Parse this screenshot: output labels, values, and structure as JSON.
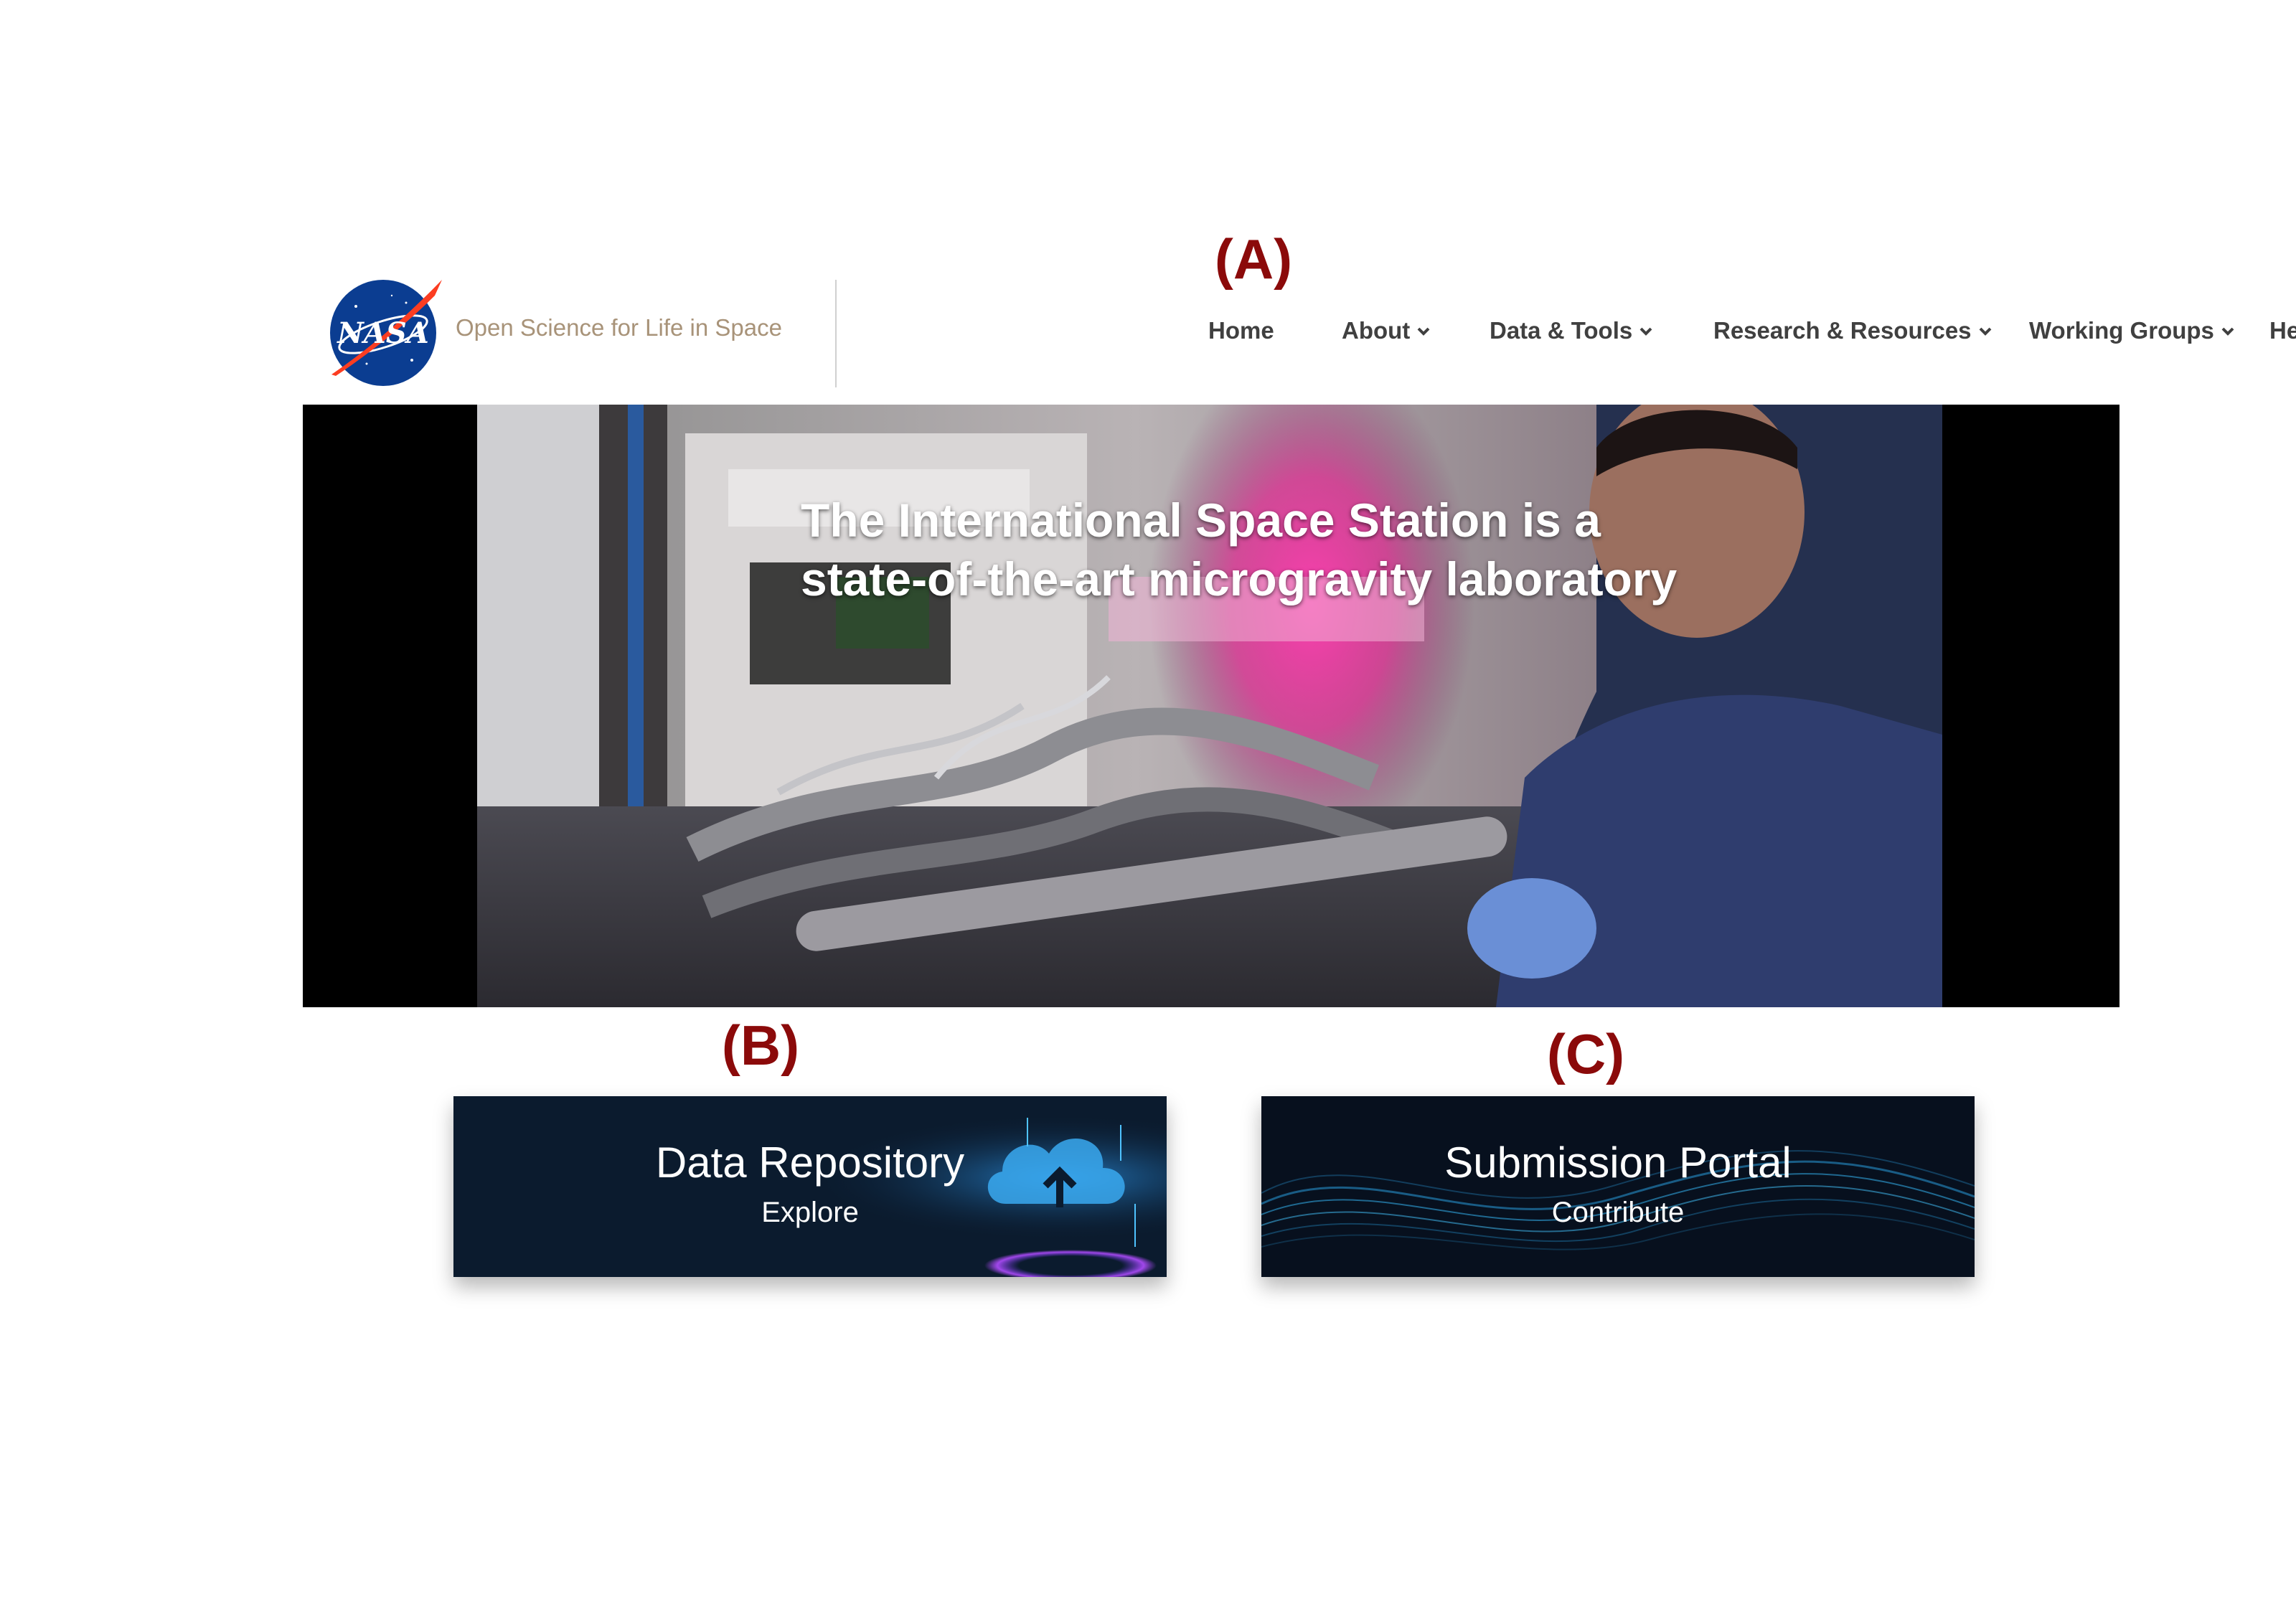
{
  "annotations": {
    "a": "(A)",
    "b": "(B)",
    "c": "(C)"
  },
  "header": {
    "logo_text": "NASA",
    "site_title": "Open Science for Life in Space",
    "nav": [
      {
        "label": "Home",
        "has_dropdown": false
      },
      {
        "label": "About",
        "has_dropdown": true
      },
      {
        "label": "Data & Tools",
        "has_dropdown": true
      },
      {
        "label": "Research & Resources",
        "has_dropdown": true
      },
      {
        "label": "Working Groups",
        "has_dropdown": true
      },
      {
        "label": "Help",
        "has_dropdown": true
      }
    ]
  },
  "hero": {
    "title_line1": "The International Space Station is a",
    "title_line2": "state-of-the-art microgravity laboratory"
  },
  "cards": {
    "data_repository": {
      "title": "Data Repository",
      "subtitle": "Explore",
      "icon": "cloud-upload-icon"
    },
    "submission_portal": {
      "title": "Submission Portal",
      "subtitle": "Contribute",
      "icon": "data-wave-graphic"
    }
  },
  "colors": {
    "annotation": "#8b0a0a",
    "brand_title": "#a89379",
    "nav_text": "#404040",
    "card_bg": "#0b1b2e",
    "nasa_blue": "#0b3d91",
    "nasa_red": "#fc3d21"
  }
}
